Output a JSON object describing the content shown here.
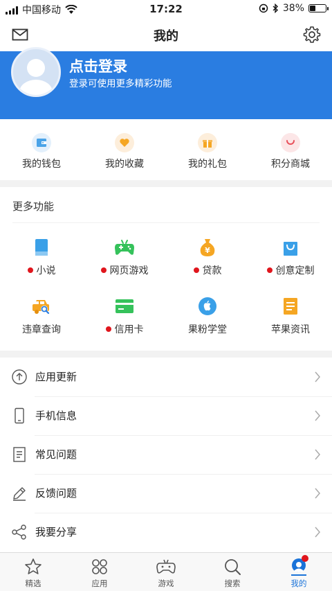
{
  "status": {
    "carrier": "中国移动",
    "time": "17:22",
    "battery": "38%",
    "battery_level": 0.38
  },
  "nav": {
    "title": "我的"
  },
  "login": {
    "title": "点击登录",
    "subtitle": "登录可使用更多精彩功能"
  },
  "quick": [
    {
      "label": "我的钱包",
      "icon": "wallet-icon",
      "color": "#4aa3e8"
    },
    {
      "label": "我的收藏",
      "icon": "heart-icon",
      "color": "#f5a623"
    },
    {
      "label": "我的礼包",
      "icon": "gift-icon",
      "color": "#f5a623"
    },
    {
      "label": "积分商城",
      "icon": "shop-icon",
      "color": "#e8505b"
    }
  ],
  "more": {
    "title": "更多功能",
    "items": [
      {
        "label": "小说",
        "icon": "book-icon",
        "dot": true
      },
      {
        "label": "网页游戏",
        "icon": "gamepad-icon",
        "dot": true
      },
      {
        "label": "贷款",
        "icon": "money-bag-icon",
        "dot": true
      },
      {
        "label": "创意定制",
        "icon": "shopping-bag-icon",
        "dot": true
      },
      {
        "label": "违章查询",
        "icon": "car-search-icon",
        "dot": false
      },
      {
        "label": "信用卡",
        "icon": "credit-card-icon",
        "dot": true
      },
      {
        "label": "果粉学堂",
        "icon": "apple-icon",
        "dot": false
      },
      {
        "label": "苹果资讯",
        "icon": "news-icon",
        "dot": false
      }
    ]
  },
  "list": [
    {
      "label": "应用更新",
      "icon": "update-icon"
    },
    {
      "label": "手机信息",
      "icon": "phone-icon"
    },
    {
      "label": "常见问题",
      "icon": "document-icon"
    },
    {
      "label": "反馈问题",
      "icon": "pencil-icon"
    },
    {
      "label": "我要分享",
      "icon": "share-icon"
    }
  ],
  "tabs": [
    {
      "label": "精选",
      "icon": "star-icon",
      "active": false
    },
    {
      "label": "应用",
      "icon": "apps-icon",
      "active": false
    },
    {
      "label": "游戏",
      "icon": "game-icon",
      "active": false
    },
    {
      "label": "搜索",
      "icon": "search-icon",
      "active": false
    },
    {
      "label": "我的",
      "icon": "profile-icon",
      "active": true
    }
  ],
  "colors": {
    "accent": "#2a7de1",
    "badge": "#e0161d",
    "tab_active": "#1a73d9"
  }
}
